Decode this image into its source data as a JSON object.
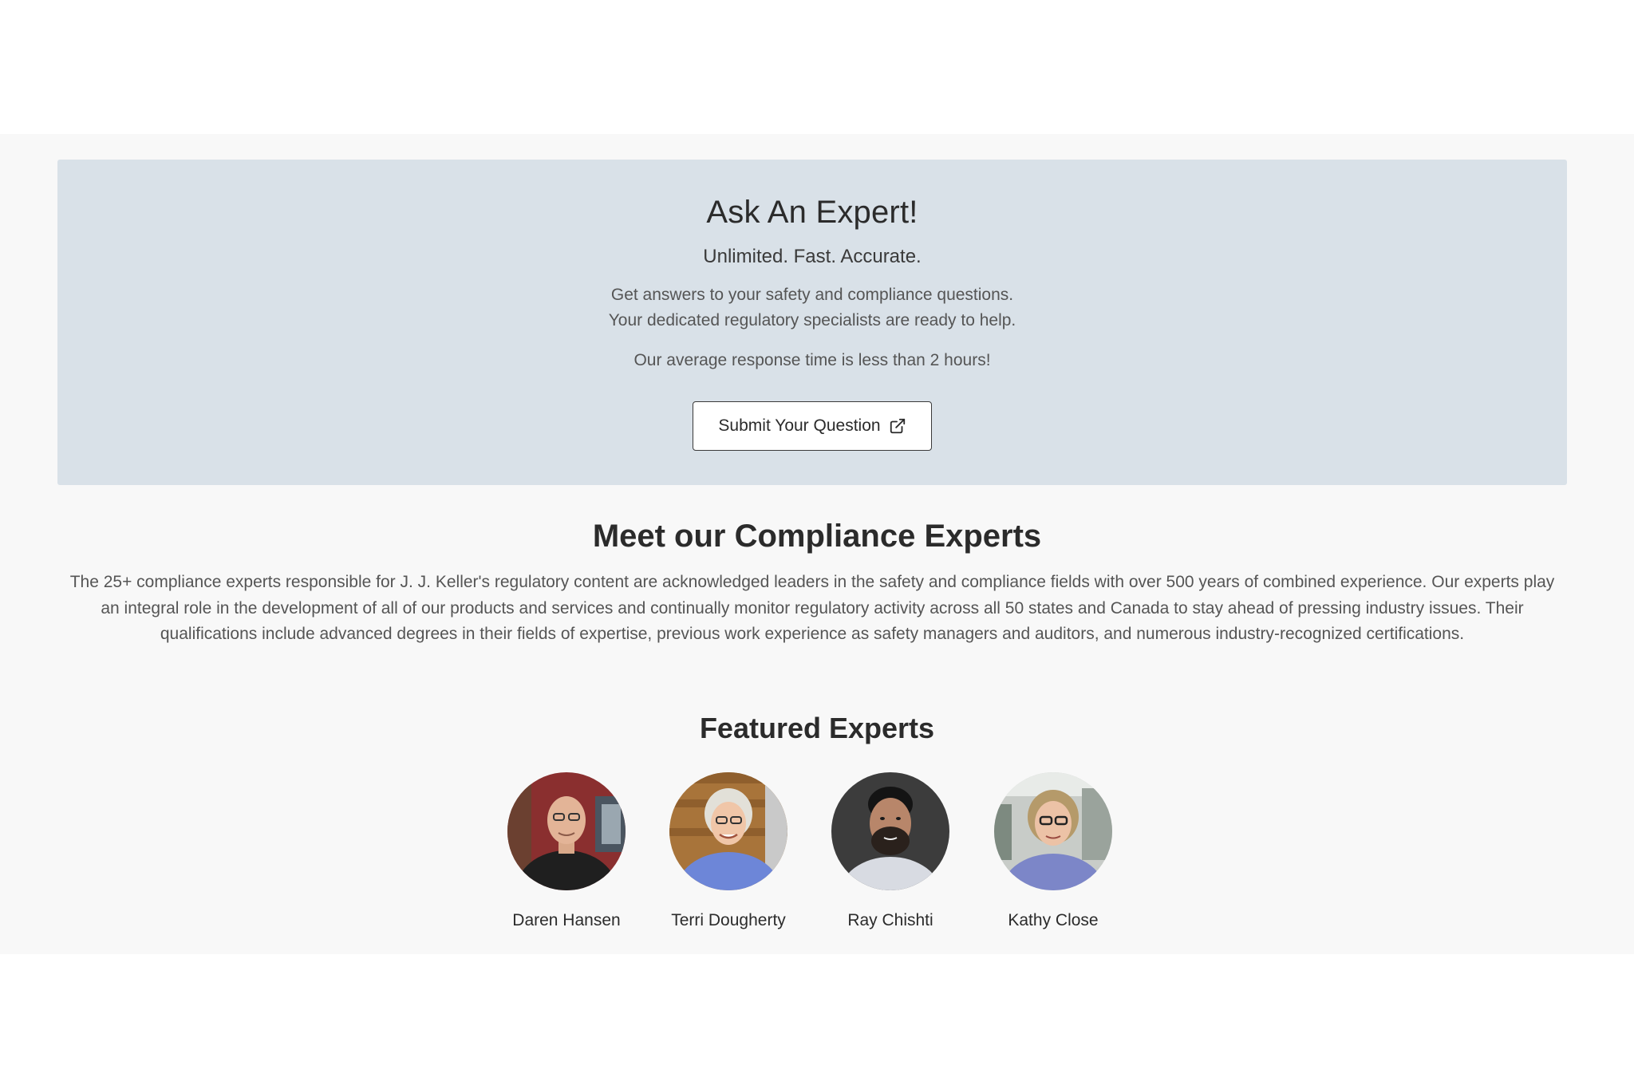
{
  "ask_expert": {
    "title": "Ask An Expert!",
    "tagline": "Unlimited. Fast. Accurate.",
    "desc_line1": "Get answers to your safety and compliance questions.",
    "desc_line2": "Your dedicated regulatory specialists are ready to help.",
    "response_time": "Our average response time is less than 2 hours!",
    "button_label": "Submit Your Question",
    "button_icon": "external-link-icon"
  },
  "meet": {
    "title": "Meet our Compliance Experts",
    "description": "The 25+ compliance experts responsible for J. J. Keller's regulatory content are acknowledged leaders in the safety and compliance fields with over 500 years of combined experience. Our experts play an integral role in the development of all of our products and services and continually monitor regulatory activity across all 50 states and Canada to stay ahead of pressing industry issues. Their qualifications include advanced degrees in their fields of expertise, previous work experience as safety managers and auditors, and numerous industry-recognized certifications."
  },
  "featured": {
    "title": "Featured Experts",
    "experts": [
      {
        "name": "Daren Hansen"
      },
      {
        "name": "Terri Dougherty"
      },
      {
        "name": "Ray Chishti"
      },
      {
        "name": "Kathy Close"
      }
    ]
  },
  "colors": {
    "panel_bg": "#d9e1e8",
    "page_bg": "#f8f8f8",
    "text_dark": "#2b2b2b",
    "text_muted": "#555555"
  }
}
